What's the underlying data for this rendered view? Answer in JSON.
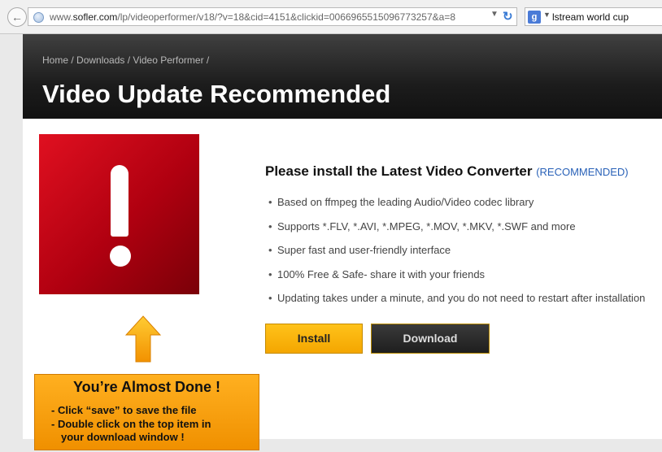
{
  "browser": {
    "url_prefix": "www.",
    "url_domain": "sofler.com",
    "url_path": "/lp/videoperformer/v18/?v=18&cid=4151&clickid=0066965515096773257&a=8",
    "search_query": "lstream world cup",
    "icons": {
      "back": "back-arrow-icon",
      "site": "globe-icon",
      "dropdown": "chevron-down-icon",
      "reload": "reload-icon",
      "search_engine": "google-icon",
      "search_dropdown": "chevron-down-icon"
    }
  },
  "banner": {
    "breadcrumb": [
      "Home",
      "Downloads",
      "Video Performer"
    ],
    "separator": " / ",
    "title": "Video Update Recommended"
  },
  "content": {
    "warning_icon": "exclamation-icon",
    "headline": "Please install the Latest Video Converter",
    "headline_tag": "(RECOMMENDED)",
    "features": [
      "Based on ffmpeg the leading Audio/Video codec library",
      "Supports *.FLV, *.AVI, *.MPEG, *.MOV, *.MKV, *.SWF and more",
      "Super fast and user-friendly interface",
      "100% Free & Safe- share it with your friends",
      "Updating takes under a minute, and you do not need to restart after installation"
    ],
    "install_label": "Install",
    "download_label": "Download"
  },
  "tip": {
    "arrow_icon": "arrow-up-icon",
    "title": "You’re Almost Done !",
    "line1": "- Click “save” to save the file",
    "line2": "- Double click on the top item in",
    "line3": "your download window !"
  },
  "colors": {
    "warning_red": "#cc0d1a",
    "accent_orange": "#f4a600",
    "banner_dark": "#1c1c1c",
    "link_blue": "#2a62b8"
  }
}
